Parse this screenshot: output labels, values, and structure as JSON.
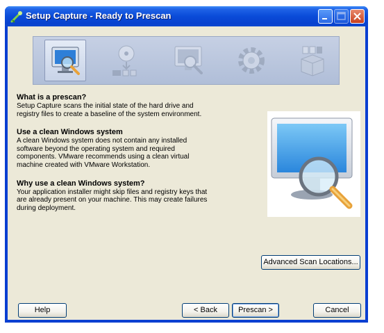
{
  "window": {
    "title": "Setup Capture - Ready to Prescan"
  },
  "steps": [
    {
      "icon": "monitor-magnifier-icon",
      "active": true
    },
    {
      "icon": "disc-install-icon",
      "active": false
    },
    {
      "icon": "monitor-scan-icon",
      "active": false
    },
    {
      "icon": "gear-icon",
      "active": false
    },
    {
      "icon": "package-box-icon",
      "active": false
    }
  ],
  "content": {
    "sections": [
      {
        "heading": "What is a prescan?",
        "lines": [
          "Setup Capture scans the initial state of the hard drive and",
          "registry files to create a baseline of the system environment."
        ]
      },
      {
        "heading": "Use a clean Windows system",
        "lines": [
          "A clean Windows system does not contain any installed",
          "software beyond the operating system and required",
          "components. VMware recommends using a clean virtual",
          "machine created with VMware Workstation."
        ]
      },
      {
        "heading": "Why use a clean Windows system?",
        "lines": [
          "Your application installer might skip files and registry keys that",
          "are already present on your machine. This may create failures",
          "during deployment."
        ]
      }
    ]
  },
  "buttons": {
    "advanced": "Advanced Scan Locations...",
    "help": "Help",
    "back": "< Back",
    "prescan": "Prescan >",
    "cancel": "Cancel"
  },
  "colors": {
    "titlebar": "#0a4bd8",
    "dialog_background": "#ece9d8",
    "banner_background": "#b8c4dc",
    "close_button": "#c8401e"
  }
}
